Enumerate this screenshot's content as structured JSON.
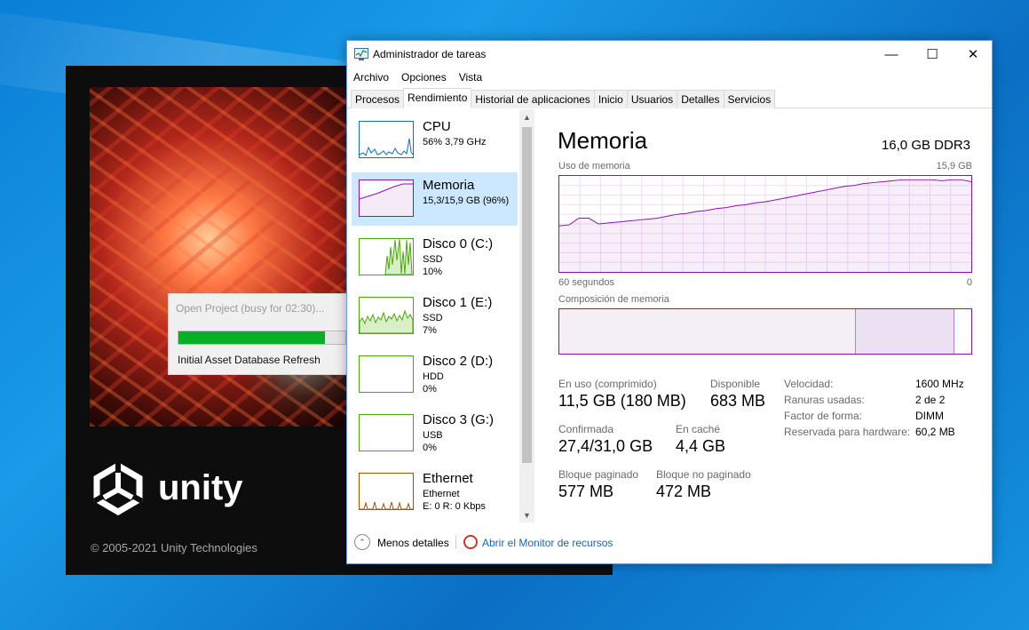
{
  "unity": {
    "logo_text": "unity",
    "copyright": "© 2005-2021 Unity Technologies",
    "dialog": {
      "title": "Open Project (busy for 02:30)...",
      "progress": 0.88,
      "status": "Initial Asset Database Refresh"
    }
  },
  "taskmgr": {
    "title": "Administrador de tareas",
    "window_buttons": {
      "minimize": "—",
      "maximize": "☐",
      "close": "✕"
    },
    "menu": [
      "Archivo",
      "Opciones",
      "Vista"
    ],
    "tabs": [
      {
        "label": "Procesos",
        "active": false
      },
      {
        "label": "Rendimiento",
        "active": true
      },
      {
        "label": "Historial de aplicaciones",
        "active": false
      },
      {
        "label": "Inicio",
        "active": false
      },
      {
        "label": "Usuarios",
        "active": false
      },
      {
        "label": "Detalles",
        "active": false
      },
      {
        "label": "Servicios",
        "active": false
      }
    ],
    "resources": [
      {
        "name": "CPU",
        "sub1": "56%  3,79 GHz",
        "sub2": "",
        "color": "#1170aa",
        "selected": false
      },
      {
        "name": "Memoria",
        "sub1": "15,3/15,9 GB (96%)",
        "sub2": "",
        "color": "#8b12ae",
        "selected": true
      },
      {
        "name": "Disco 0 (C:)",
        "sub1": "SSD",
        "sub2": "10%",
        "color": "#4da60c",
        "selected": false
      },
      {
        "name": "Disco 1 (E:)",
        "sub1": "SSD",
        "sub2": "7%",
        "color": "#4da60c",
        "selected": false
      },
      {
        "name": "Disco 2 (D:)",
        "sub1": "HDD",
        "sub2": "0%",
        "color": "#4da60c",
        "selected": false
      },
      {
        "name": "Disco 3 (G:)",
        "sub1": "USB",
        "sub2": "0%",
        "color": "#4da60c",
        "selected": false
      },
      {
        "name": "Ethernet",
        "sub1": "Ethernet",
        "sub2": "E: 0 R: 0 Kbps",
        "color": "#a74f01",
        "selected": false
      }
    ],
    "memory": {
      "title": "Memoria",
      "spec": "16,0 GB DDR3",
      "usage_label": "Uso de memoria",
      "usage_max": "15,9 GB",
      "time_left": "60 segundos",
      "time_right": "0",
      "composition_label": "Composición de memoria",
      "composition": [
        {
          "segment": "in-use",
          "fraction": 0.72,
          "color": "#f4eff7"
        },
        {
          "segment": "standby",
          "fraction": 0.24,
          "color": "#ece0f3"
        },
        {
          "segment": "free",
          "fraction": 0.04,
          "color": "#ffffff"
        }
      ],
      "usage_history": [
        0.48,
        0.49,
        0.56,
        0.56,
        0.5,
        0.51,
        0.52,
        0.53,
        0.54,
        0.55,
        0.56,
        0.58,
        0.6,
        0.61,
        0.63,
        0.64,
        0.66,
        0.67,
        0.69,
        0.7,
        0.72,
        0.73,
        0.75,
        0.77,
        0.79,
        0.81,
        0.83,
        0.85,
        0.87,
        0.89,
        0.9,
        0.92,
        0.93,
        0.94,
        0.95,
        0.96,
        0.96,
        0.96,
        0.96,
        0.95,
        0.96,
        0.96,
        0.94
      ],
      "stats": [
        {
          "label": "En uso (comprimido)",
          "value": "11,5 GB (180 MB)"
        },
        {
          "label": "Disponible",
          "value": "683 MB"
        },
        {
          "label": "Confirmada",
          "value": "27,4/31,0 GB"
        },
        {
          "label": "En caché",
          "value": "4,4 GB"
        },
        {
          "label": "Bloque paginado",
          "value": "577 MB"
        },
        {
          "label": "Bloque no paginado",
          "value": "472 MB"
        }
      ],
      "details": [
        {
          "key": "Velocidad:",
          "value": "1600 MHz"
        },
        {
          "key": "Ranuras usadas:",
          "value": "2 de 2"
        },
        {
          "key": "Factor de forma:",
          "value": "DIMM"
        },
        {
          "key": "Reservada para hardware:",
          "value": "60,2 MB"
        }
      ]
    },
    "footer": {
      "less_details": "Menos detalles",
      "resource_monitor": "Abrir el Monitor de recursos"
    }
  }
}
